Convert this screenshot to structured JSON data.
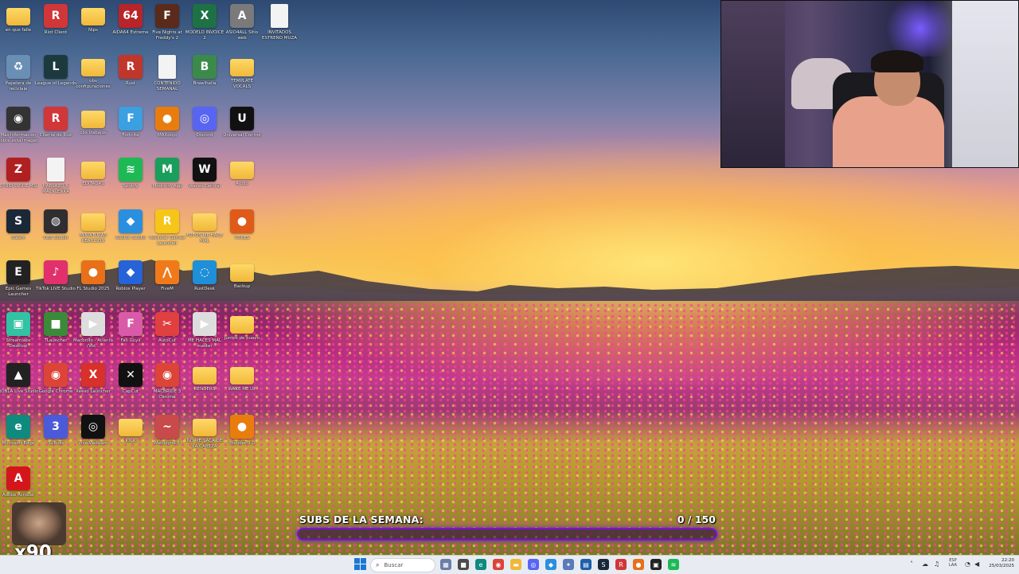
{
  "desktop": {
    "icons": [
      {
        "label": "en que falle",
        "name": "folder-icon",
        "type": "folder",
        "glyph": "",
        "color": "",
        "col": 0,
        "row": 0
      },
      {
        "label": "Riot Client",
        "name": "riot-client-icon",
        "type": "app",
        "glyph": "R",
        "color": "#d13639",
        "col": 1,
        "row": 0
      },
      {
        "label": "Nips",
        "name": "folder-icon",
        "type": "folder",
        "glyph": "",
        "color": "",
        "col": 2,
        "row": 0
      },
      {
        "label": "AIDA64 Extreme",
        "name": "aida64-icon",
        "type": "app",
        "glyph": "64",
        "color": "#b8242a",
        "col": 3,
        "row": 0
      },
      {
        "label": "Five Nights at Freddy's 2",
        "name": "fnaf-icon",
        "type": "app",
        "glyph": "F",
        "color": "#5a2a1a",
        "col": 4,
        "row": 0
      },
      {
        "label": "MODELO INVOICE 2",
        "name": "excel-icon",
        "type": "app",
        "glyph": "X",
        "color": "#1e7145",
        "col": 5,
        "row": 0
      },
      {
        "label": "ASIO4ALL Sitio web",
        "name": "asio-icon",
        "type": "app",
        "glyph": "A",
        "color": "#7a7a7a",
        "col": 6,
        "row": 0
      },
      {
        "label": "INVITADOS ESTRENO MUZA",
        "name": "document-icon",
        "type": "doc",
        "glyph": "",
        "color": "",
        "col": 7,
        "row": 0
      },
      {
        "label": "Papelera de reciclaje",
        "name": "recycle-bin-icon",
        "type": "app",
        "glyph": "♻",
        "color": "#6a8fb5",
        "col": 0,
        "row": 1
      },
      {
        "label": "League of Legends",
        "name": "league-icon",
        "type": "app",
        "glyph": "L",
        "color": "#1c3a3e",
        "col": 1,
        "row": 1
      },
      {
        "label": "obs configuraciones",
        "name": "folder-icon",
        "type": "folder",
        "glyph": "",
        "color": "",
        "col": 2,
        "row": 1
      },
      {
        "label": "Rust",
        "name": "rust-icon",
        "type": "app",
        "glyph": "R",
        "color": "#c1362b",
        "col": 3,
        "row": 1
      },
      {
        "label": "CONTENIDO SEMANAL",
        "name": "document-icon",
        "type": "doc",
        "glyph": "",
        "color": "",
        "col": 4,
        "row": 1
      },
      {
        "label": "Brawlhalla",
        "name": "brawlhalla-icon",
        "type": "app",
        "glyph": "B",
        "color": "#3c8a4a",
        "col": 5,
        "row": 1
      },
      {
        "label": "TEMPLATE VOCALS",
        "name": "folder-icon",
        "type": "folder",
        "glyph": "",
        "color": "",
        "col": 6,
        "row": 1
      },
      {
        "label": "Más información sobre esta imagen",
        "name": "info-icon",
        "type": "app",
        "glyph": "◉",
        "color": "#333",
        "col": 0,
        "row": 2
      },
      {
        "label": "Cliente de Riot",
        "name": "riot-client-icon",
        "type": "app",
        "glyph": "R",
        "color": "#d13639",
        "col": 1,
        "row": 2
      },
      {
        "label": "obs trabajos",
        "name": "folder-icon",
        "type": "folder",
        "glyph": "",
        "color": "",
        "col": 2,
        "row": 2
      },
      {
        "label": "Fortnite",
        "name": "fortnite-icon",
        "type": "app",
        "glyph": "F",
        "color": "#3aa0e0",
        "col": 3,
        "row": 2
      },
      {
        "label": "MAXdojo",
        "name": "blender-icon",
        "type": "app",
        "glyph": "●",
        "color": "#e87d0d",
        "col": 4,
        "row": 2
      },
      {
        "label": "Discord",
        "name": "discord-icon",
        "type": "app",
        "glyph": "◎",
        "color": "#5865f2",
        "col": 5,
        "row": 2
      },
      {
        "label": "Universal Control",
        "name": "universal-control-icon",
        "type": "app",
        "glyph": "U",
        "color": "#111",
        "col": 6,
        "row": 2
      },
      {
        "label": "CPUID CPU-Z MSI",
        "name": "cpuz-icon",
        "type": "app",
        "glyph": "Z",
        "color": "#b02020",
        "col": 0,
        "row": 3
      },
      {
        "label": "HABLAZO ft MACKLENKA",
        "name": "document-icon",
        "type": "doc",
        "glyph": "",
        "color": "",
        "col": 1,
        "row": 3
      },
      {
        "label": "EDITADAS",
        "name": "folder-icon",
        "type": "folder",
        "glyph": "",
        "color": "",
        "col": 2,
        "row": 3
      },
      {
        "label": "Spotify",
        "name": "spotify-icon",
        "type": "app",
        "glyph": "≋",
        "color": "#1db954",
        "col": 3,
        "row": 3
      },
      {
        "label": "Modrinth App",
        "name": "modrinth-icon",
        "type": "app",
        "glyph": "M",
        "color": "#1a9e5b",
        "col": 4,
        "row": 3
      },
      {
        "label": "Waves Central",
        "name": "waves-icon",
        "type": "app",
        "glyph": "W",
        "color": "#111",
        "col": 5,
        "row": 3
      },
      {
        "label": "Audio",
        "name": "folder-icon",
        "type": "folder",
        "glyph": "",
        "color": "",
        "col": 6,
        "row": 3
      },
      {
        "label": "Steam",
        "name": "steam-icon",
        "type": "app",
        "glyph": "S",
        "color": "#1b2838",
        "col": 0,
        "row": 4
      },
      {
        "label": "OBS Studio",
        "name": "obs-icon",
        "type": "app",
        "glyph": "◍",
        "color": "#302e31",
        "col": 1,
        "row": 4
      },
      {
        "label": "MINIATURAS REACCION",
        "name": "folder-icon",
        "type": "folder",
        "glyph": "",
        "color": "",
        "col": 2,
        "row": 4
      },
      {
        "label": "Roblox Studio",
        "name": "roblox-studio-icon",
        "type": "app",
        "glyph": "◆",
        "color": "#2b8fe0",
        "col": 3,
        "row": 4
      },
      {
        "label": "Rockstar Games Launcher",
        "name": "rockstar-icon",
        "type": "app",
        "glyph": "R",
        "color": "#f5c518",
        "col": 4,
        "row": 4
      },
      {
        "label": "FOTOS ME HACE MAL",
        "name": "folder-icon",
        "type": "folder",
        "glyph": "",
        "color": "",
        "col": 5,
        "row": 4
      },
      {
        "label": "VOCES",
        "name": "fl-studio-icon",
        "type": "app",
        "glyph": "●",
        "color": "#e05a1a",
        "col": 6,
        "row": 4
      },
      {
        "label": "Epic Games Launcher",
        "name": "epic-games-icon",
        "type": "app",
        "glyph": "E",
        "color": "#222",
        "col": 0,
        "row": 5
      },
      {
        "label": "TikTok LIVE Studio",
        "name": "tiktok-icon",
        "type": "app",
        "glyph": "♪",
        "color": "#e1306c",
        "col": 1,
        "row": 5
      },
      {
        "label": "FL Studio 2025",
        "name": "fl-studio-icon",
        "type": "app",
        "glyph": "●",
        "color": "#e8701a",
        "col": 2,
        "row": 5
      },
      {
        "label": "Roblox Player",
        "name": "roblox-icon",
        "type": "app",
        "glyph": "◆",
        "color": "#2663d8",
        "col": 3,
        "row": 5
      },
      {
        "label": "FiveM",
        "name": "fivem-icon",
        "type": "app",
        "glyph": "⋀",
        "color": "#f07a1a",
        "col": 4,
        "row": 5
      },
      {
        "label": "RustDesk",
        "name": "rustdesk-icon",
        "type": "app",
        "glyph": "◌",
        "color": "#1e8fd8",
        "col": 5,
        "row": 5
      },
      {
        "label": "Backup",
        "name": "folder-icon",
        "type": "folder",
        "glyph": "",
        "color": "",
        "col": 6,
        "row": 5
      },
      {
        "label": "Streamlabs Desktop",
        "name": "streamlabs-icon",
        "type": "app",
        "glyph": "▣",
        "color": "#31c3a2",
        "col": 0,
        "row": 6
      },
      {
        "label": "TLauncher",
        "name": "tlauncher-icon",
        "type": "app",
        "glyph": "■",
        "color": "#3a8a3a",
        "col": 1,
        "row": 6
      },
      {
        "label": "Macbrillo - Atlanta (Vid...",
        "name": "video-icon",
        "type": "app",
        "glyph": "▶",
        "color": "#ddd",
        "col": 2,
        "row": 6
      },
      {
        "label": "Fall Guys",
        "name": "fall-guys-icon",
        "type": "app",
        "glyph": "F",
        "color": "#d95aa8",
        "col": 3,
        "row": 6
      },
      {
        "label": "AutoCut",
        "name": "autocut-icon",
        "type": "app",
        "glyph": "✂",
        "color": "#e04040",
        "col": 4,
        "row": 6
      },
      {
        "label": "ME HACES MAL master",
        "name": "video-icon",
        "type": "app",
        "glyph": "▶",
        "color": "#ddd",
        "col": 5,
        "row": 6
      },
      {
        "label": "juntos de nuevo",
        "name": "folder-icon",
        "type": "folder",
        "glyph": "",
        "color": "",
        "col": 6,
        "row": 6
      },
      {
        "label": "ROBLA Live Studio",
        "name": "robla-icon",
        "type": "app",
        "glyph": "▲",
        "color": "#222",
        "col": 0,
        "row": 7
      },
      {
        "label": "Google Chrome",
        "name": "chrome-icon",
        "type": "app",
        "glyph": "◉",
        "color": "#db4437",
        "col": 1,
        "row": 7
      },
      {
        "label": "Xeeso Launcher",
        "name": "xeeso-icon",
        "type": "app",
        "glyph": "X",
        "color": "#d8302a",
        "col": 2,
        "row": 7
      },
      {
        "label": "CapCut",
        "name": "capcut-icon",
        "type": "app",
        "glyph": "✕",
        "color": "#111",
        "col": 3,
        "row": 7
      },
      {
        "label": "MACBRIDE 3 Chrome",
        "name": "chrome-icon",
        "type": "app",
        "glyph": "◉",
        "color": "#db4437",
        "col": 4,
        "row": 7
      },
      {
        "label": "RENDERS",
        "name": "folder-icon",
        "type": "folder",
        "glyph": "",
        "color": "",
        "col": 5,
        "row": 7
      },
      {
        "label": "WAKE ME UP",
        "name": "folder-icon",
        "type": "folder",
        "glyph": "",
        "color": "",
        "col": 6,
        "row": 7
      },
      {
        "label": "Microsoft Edge",
        "name": "edge-icon",
        "type": "app",
        "glyph": "e",
        "color": "#0f8a7e",
        "col": 0,
        "row": 8
      },
      {
        "label": "3uTools",
        "name": "3utools-icon",
        "type": "app",
        "glyph": "3",
        "color": "#4a5ad8",
        "col": 1,
        "row": 8
      },
      {
        "label": "Vive Webcam",
        "name": "webcam-app-icon",
        "type": "app",
        "glyph": "◎",
        "color": "#111",
        "col": 2,
        "row": 8
      },
      {
        "label": "KICK",
        "name": "folder-icon",
        "type": "folder",
        "glyph": "",
        "color": "",
        "col": 3,
        "row": 8
      },
      {
        "label": "Melodyne 5",
        "name": "melodyne-icon",
        "type": "app",
        "glyph": "~",
        "color": "#c84a4a",
        "col": 4,
        "row": 8
      },
      {
        "label": "NO ME SACA DE LA CABEZA",
        "name": "folder-icon",
        "type": "folder",
        "glyph": "",
        "color": "",
        "col": 5,
        "row": 8
      },
      {
        "label": "Blender 3.0",
        "name": "blender-icon",
        "type": "app",
        "glyph": "●",
        "color": "#e87d0d",
        "col": 6,
        "row": 8
      },
      {
        "label": "Adobe Acrobat",
        "name": "acrobat-icon",
        "type": "app",
        "glyph": "A",
        "color": "#d4161c",
        "col": 0,
        "row": 9
      }
    ]
  },
  "webcam": {
    "label": "webcam-overlay"
  },
  "subs": {
    "label": "SUBS DE LA SEMANA:",
    "current": "0",
    "separator": "/",
    "goal": "150",
    "progress": 0
  },
  "emote": {
    "count": "x90"
  },
  "taskbar": {
    "search_placeholder": "Buscar",
    "apps": [
      {
        "name": "widget-icon",
        "glyph": "▦",
        "color": "#6a7ea8"
      },
      {
        "name": "file-explorer-icon",
        "glyph": "■",
        "color": "#4a4a4a"
      },
      {
        "name": "edge-taskbar-icon",
        "glyph": "e",
        "color": "#0f8a7e"
      },
      {
        "name": "chrome-taskbar-icon",
        "glyph": "◉",
        "color": "#db4437"
      },
      {
        "name": "folder-taskbar-icon",
        "glyph": "▬",
        "color": "#f0b83a"
      },
      {
        "name": "discord-taskbar-icon",
        "glyph": "◎",
        "color": "#5865f2"
      },
      {
        "name": "tool-taskbar-icon",
        "glyph": "◆",
        "color": "#2b8fe0"
      },
      {
        "name": "app-taskbar-icon",
        "glyph": "✦",
        "color": "#5a7ab8"
      },
      {
        "name": "calculator-taskbar-icon",
        "glyph": "▤",
        "color": "#1e5fa8"
      },
      {
        "name": "steam-taskbar-icon",
        "glyph": "S",
        "color": "#1b2838"
      },
      {
        "name": "riot-taskbar-icon",
        "glyph": "R",
        "color": "#d13639"
      },
      {
        "name": "fl-studio-taskbar-icon",
        "glyph": "●",
        "color": "#e8701a"
      },
      {
        "name": "terminal-taskbar-icon",
        "glyph": "▣",
        "color": "#222"
      },
      {
        "name": "spotify-taskbar-icon",
        "glyph": "≋",
        "color": "#1db954"
      }
    ],
    "tray": {
      "language_line1": "ESP",
      "language_line2": "LAA",
      "time": "22:20",
      "date": "25/03/2025"
    }
  }
}
